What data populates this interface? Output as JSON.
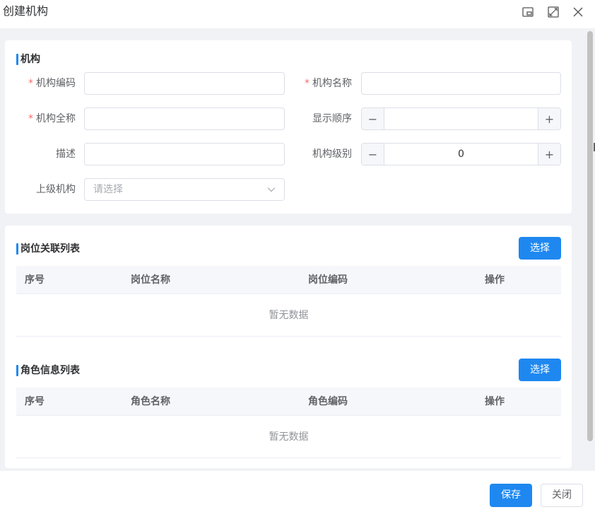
{
  "dialog": {
    "title": "创建机构"
  },
  "section_org": {
    "title": "机构",
    "fields": {
      "code_label": "机构编码",
      "name_label": "机构名称",
      "fullname_label": "机构全称",
      "order_label": "显示顺序",
      "desc_label": "描述",
      "level_label": "机构级别",
      "level_value": "0",
      "parent_label": "上级机构",
      "parent_placeholder": "请选择"
    },
    "required_mark": "*",
    "minus": "−",
    "plus": "+"
  },
  "section_post": {
    "title": "岗位关联列表",
    "select_label": "选择",
    "columns": [
      "序号",
      "岗位名称",
      "岗位编码",
      "操作"
    ],
    "empty_text": "暂无数据"
  },
  "section_role": {
    "title": "角色信息列表",
    "select_label": "选择",
    "columns": [
      "序号",
      "角色名称",
      "角色编码",
      "操作"
    ],
    "empty_text": "暂无数据"
  },
  "footer": {
    "save_label": "保存",
    "close_label": "关闭"
  },
  "colors": {
    "primary": "#1e88f0",
    "required": "#f56c6c",
    "background": "#f0f2f5"
  },
  "icons": [
    "restore-window-icon",
    "maximize-icon",
    "close-icon",
    "chevron-down-icon"
  ]
}
